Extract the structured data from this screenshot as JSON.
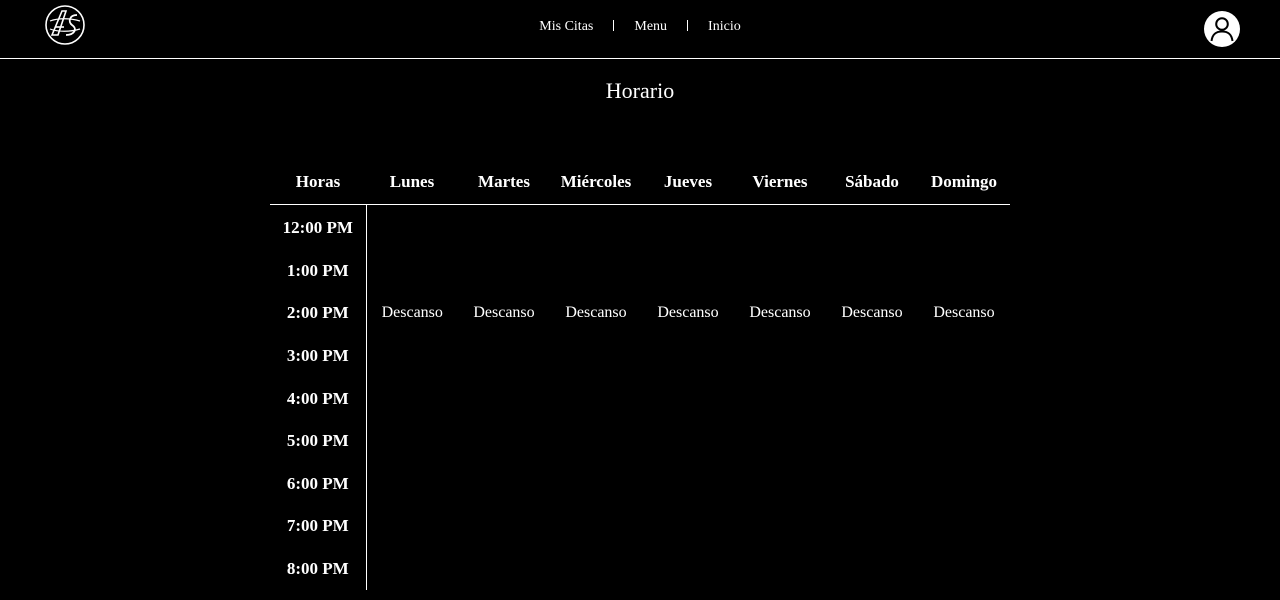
{
  "nav": {
    "links": [
      "Mis Citas",
      "Menu",
      "Inicio"
    ]
  },
  "icons": {
    "logo": "brand-logo-icon",
    "avatar": "user-avatar-icon"
  },
  "colors": {
    "background": "#000000",
    "foreground": "#ffffff"
  },
  "page": {
    "title": "Horario"
  },
  "schedule": {
    "headers": [
      "Horas",
      "Lunes",
      "Martes",
      "Miércoles",
      "Jueves",
      "Viernes",
      "Sábado",
      "Domingo"
    ],
    "rows": [
      {
        "hour": "12:00 PM",
        "cells": [
          "",
          "",
          "",
          "",
          "",
          "",
          ""
        ]
      },
      {
        "hour": "1:00 PM",
        "cells": [
          "",
          "",
          "",
          "",
          "",
          "",
          ""
        ]
      },
      {
        "hour": "2:00 PM",
        "cells": [
          "Descanso",
          "Descanso",
          "Descanso",
          "Descanso",
          "Descanso",
          "Descanso",
          "Descanso"
        ]
      },
      {
        "hour": "3:00 PM",
        "cells": [
          "",
          "",
          "",
          "",
          "",
          "",
          ""
        ]
      },
      {
        "hour": "4:00 PM",
        "cells": [
          "",
          "",
          "",
          "",
          "",
          "",
          ""
        ]
      },
      {
        "hour": "5:00 PM",
        "cells": [
          "",
          "",
          "",
          "",
          "",
          "",
          ""
        ]
      },
      {
        "hour": "6:00 PM",
        "cells": [
          "",
          "",
          "",
          "",
          "",
          "",
          ""
        ]
      },
      {
        "hour": "7:00 PM",
        "cells": [
          "",
          "",
          "",
          "",
          "",
          "",
          ""
        ]
      },
      {
        "hour": "8:00 PM",
        "cells": [
          "",
          "",
          "",
          "",
          "",
          "",
          ""
        ]
      }
    ]
  }
}
